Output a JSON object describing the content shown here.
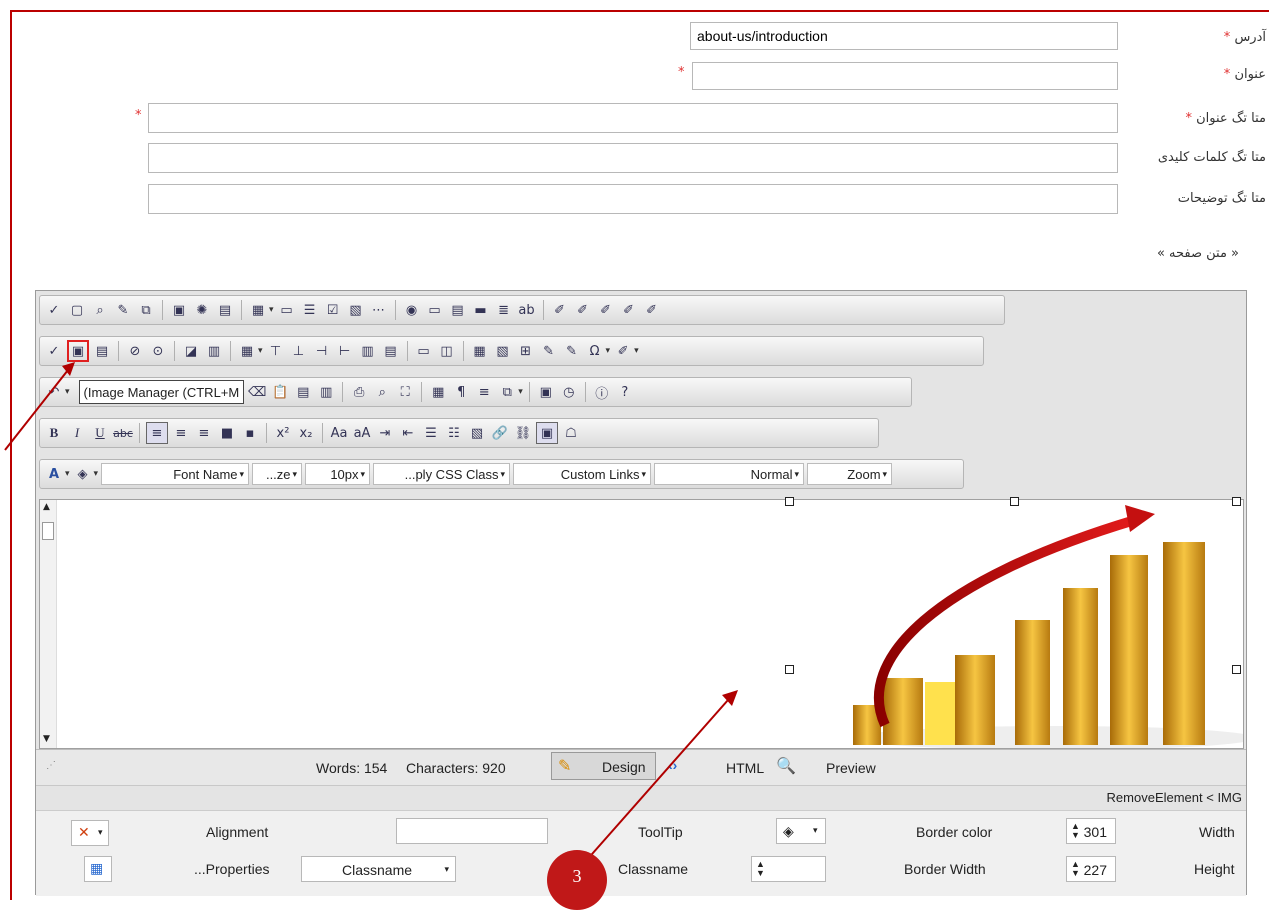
{
  "form": {
    "address_label": "آدرس",
    "address_value": "about-us/introduction",
    "title_label": "عنوان",
    "meta_title_label": "متا تگ عنوان",
    "meta_keywords_label": "متا تگ کلمات کلیدی",
    "meta_description_label": "متا تگ توضیحات",
    "required_mark": "*",
    "page_text_label": "« متن صفحه »"
  },
  "toolbar": {
    "tooltip": "(Image Manager (CTRL+M",
    "font_name": "Font Name",
    "font_size": "...ze",
    "real_font_size": "10px",
    "css_class": "...ply CSS Class",
    "custom_links": "Custom Links",
    "paragraph": "Normal",
    "zoom": "Zoom",
    "omega": "Ω"
  },
  "status": {
    "words": "Words: 154",
    "characters": "Characters: 920",
    "design": "Design",
    "html": "HTML",
    "preview": "Preview"
  },
  "path": "RemoveElement < IMG",
  "properties": {
    "alignment": "Alignment",
    "tooltip": "ToolTip",
    "border_color": "Border color",
    "width_label": "Width",
    "width_value": "301",
    "properties_btn": "...Properties",
    "classname_dd": "Classname",
    "classname_label": "Classname",
    "border_width": "Border Width",
    "height_label": "Height",
    "height_value": "227"
  },
  "annotation": {
    "step": "3"
  },
  "colors": {
    "accent_red": "#e02020",
    "frame_red": "#b00000",
    "gold": "#d89a1a"
  }
}
